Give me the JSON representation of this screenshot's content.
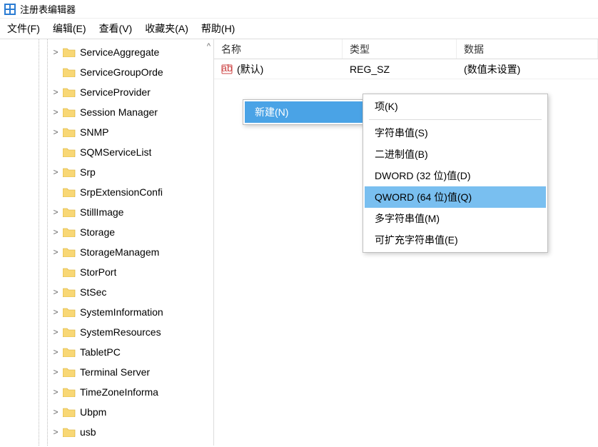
{
  "window": {
    "title": "注册表编辑器"
  },
  "menubar": {
    "file": "文件(F)",
    "edit": "编辑(E)",
    "view": "查看(V)",
    "favorites": "收藏夹(A)",
    "help": "帮助(H)"
  },
  "tree": {
    "items": [
      {
        "expandable": true,
        "label": "ServiceAggregate"
      },
      {
        "expandable": false,
        "label": "ServiceGroupOrde"
      },
      {
        "expandable": true,
        "label": "ServiceProvider"
      },
      {
        "expandable": true,
        "label": "Session Manager"
      },
      {
        "expandable": true,
        "label": "SNMP"
      },
      {
        "expandable": false,
        "label": "SQMServiceList"
      },
      {
        "expandable": true,
        "label": "Srp"
      },
      {
        "expandable": false,
        "label": "SrpExtensionConfi"
      },
      {
        "expandable": true,
        "label": "StillImage"
      },
      {
        "expandable": true,
        "label": "Storage"
      },
      {
        "expandable": true,
        "label": "StorageManagem"
      },
      {
        "expandable": false,
        "label": "StorPort"
      },
      {
        "expandable": true,
        "label": "StSec"
      },
      {
        "expandable": true,
        "label": "SystemInformation"
      },
      {
        "expandable": true,
        "label": "SystemResources"
      },
      {
        "expandable": true,
        "label": "TabletPC"
      },
      {
        "expandable": true,
        "label": "Terminal Server"
      },
      {
        "expandable": true,
        "label": "TimeZoneInforma"
      },
      {
        "expandable": true,
        "label": "Ubpm"
      },
      {
        "expandable": true,
        "label": "usb"
      }
    ],
    "scroll_caret": "^"
  },
  "list": {
    "columns": {
      "name": "名称",
      "type": "类型",
      "data": "数据"
    },
    "rows": [
      {
        "name": "(默认)",
        "type": "REG_SZ",
        "data": "(数值未设置)"
      }
    ]
  },
  "context": {
    "primary": {
      "new": "新建(N)"
    },
    "sub": {
      "key": "项(K)",
      "string": "字符串值(S)",
      "binary": "二进制值(B)",
      "dword": "DWORD (32 位)值(D)",
      "qword": "QWORD (64 位)值(Q)",
      "multi": "多字符串值(M)",
      "expand": "可扩充字符串值(E)"
    }
  },
  "icons": {
    "expander": ">",
    "submenu_arrow": "›"
  }
}
